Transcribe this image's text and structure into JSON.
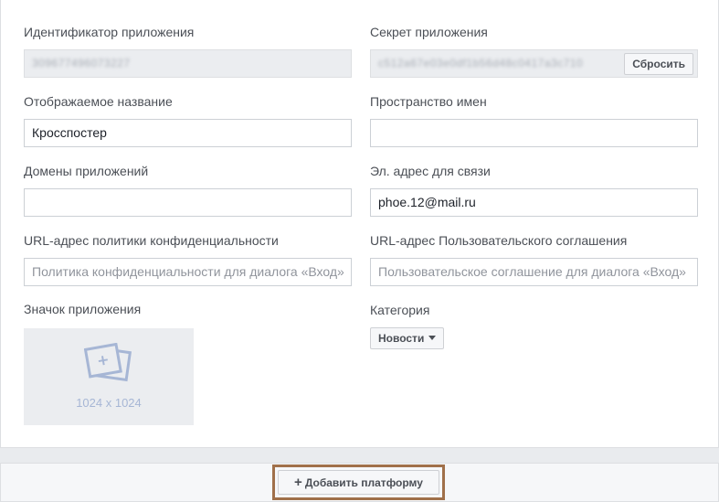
{
  "app_id": {
    "label": "Идентификатор приложения",
    "value": "309677496073227"
  },
  "app_secret": {
    "label": "Секрет приложения",
    "value": "c512a67e03e0df1b56d48c0417a3c710",
    "reset_label": "Сбросить"
  },
  "display_name": {
    "label": "Отображаемое название",
    "value": "Кросспостер"
  },
  "namespace": {
    "label": "Пространство имен",
    "value": ""
  },
  "app_domains": {
    "label": "Домены приложений",
    "value": ""
  },
  "contact_email": {
    "label": "Эл. адрес для связи",
    "value": "phoe.12@mail.ru"
  },
  "privacy_url": {
    "label": "URL-адрес политики конфиденциальности",
    "placeholder": "Политика конфиденциальности для диалога «Вход»"
  },
  "terms_url": {
    "label": "URL-адрес Пользовательского соглашения",
    "placeholder": "Пользовательское соглашение для диалога «Вход»"
  },
  "app_icon": {
    "label": "Значок приложения",
    "size_text": "1024 x 1024",
    "icon": "photo-add-icon"
  },
  "category": {
    "label": "Категория",
    "selected": "Новости"
  },
  "add_platform": {
    "label": "Добавить платформу",
    "icon": "plus-icon"
  },
  "colors": {
    "highlight_border": "#a0704a",
    "input_border": "#ccd0d5",
    "disabled_bg": "#ebedf0"
  }
}
